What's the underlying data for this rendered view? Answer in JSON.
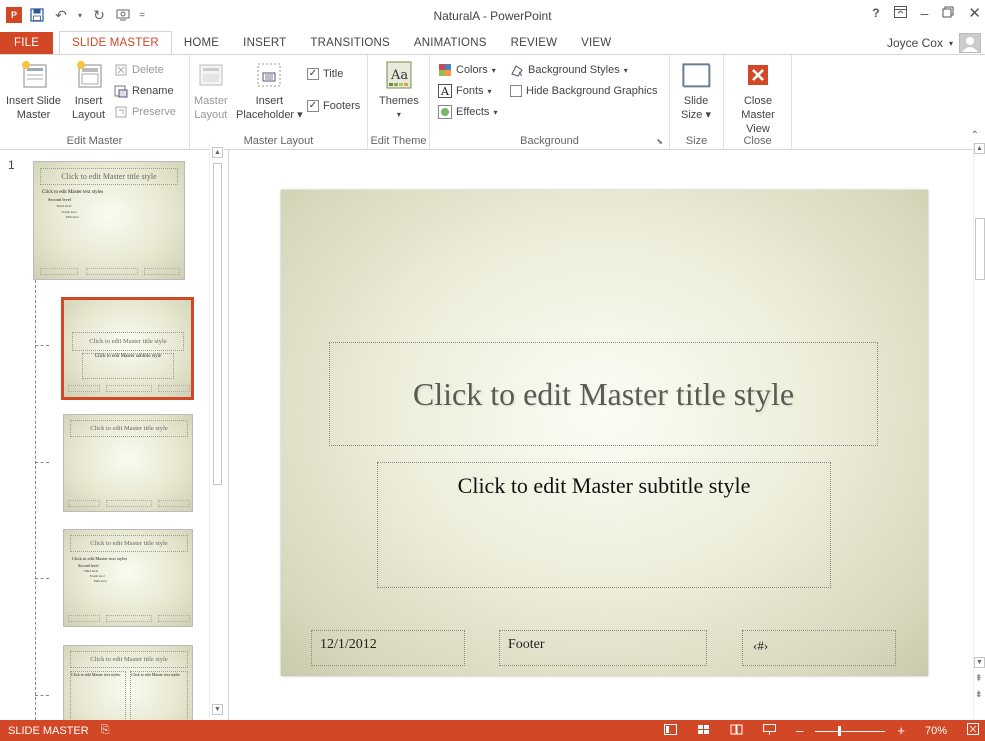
{
  "window": {
    "title": "NaturalA - PowerPoint",
    "help_icon": "?",
    "ribbon_display_icon": "ribbon-display-icon"
  },
  "tabs": [
    {
      "label": "FILE"
    },
    {
      "label": "SLIDE MASTER"
    },
    {
      "label": "HOME"
    },
    {
      "label": "INSERT"
    },
    {
      "label": "TRANSITIONS"
    },
    {
      "label": "ANIMATIONS"
    },
    {
      "label": "REVIEW"
    },
    {
      "label": "VIEW"
    }
  ],
  "user": {
    "name": "Joyce Cox"
  },
  "ribbon": {
    "edit_master": {
      "label": "Edit Master",
      "insert_slide_master": [
        "Insert Slide",
        "Master"
      ],
      "insert_layout": [
        "Insert",
        "Layout"
      ],
      "delete": "Delete",
      "rename": "Rename",
      "preserve": "Preserve"
    },
    "master_layout": {
      "label": "Master Layout",
      "master_layout_btn": [
        "Master",
        "Layout"
      ],
      "insert_placeholder": [
        "Insert",
        "Placeholder"
      ],
      "title_check": "Title",
      "footers_check": "Footers"
    },
    "edit_theme": {
      "label": "Edit Theme",
      "themes": "Themes"
    },
    "background": {
      "label": "Background",
      "colors": "Colors",
      "fonts": "Fonts",
      "effects": "Effects",
      "background_styles": "Background Styles",
      "hide_bg_graphics": "Hide Background Graphics"
    },
    "size": {
      "label": "Size",
      "slide_size": [
        "Slide",
        "Size"
      ]
    },
    "close": {
      "label": "Close",
      "close_master_view": [
        "Close",
        "Master View"
      ]
    }
  },
  "thumbnails": {
    "first_number": "1",
    "master_title": "Click to edit Master title style",
    "master_text": "Click to edit Master text styles",
    "second_level": "Second level",
    "third_level": "Third level",
    "fourth_level": "Fourth level",
    "fifth_level": "Fifth level",
    "subtitle": "Click to edit Master subtitle style",
    "footer": "Footer",
    "click_to_edit_master_text": "Click to edit Master text styles"
  },
  "slide": {
    "title": "Click to edit Master title style",
    "subtitle": "Click to edit Master subtitle style",
    "date": "12/1/2012",
    "footer": "Footer",
    "number": "‹#›"
  },
  "status": {
    "view_name": "SLIDE MASTER",
    "zoom": "70%",
    "zoom_level": 0.7
  },
  "colors": {
    "accent": "#d24726"
  }
}
